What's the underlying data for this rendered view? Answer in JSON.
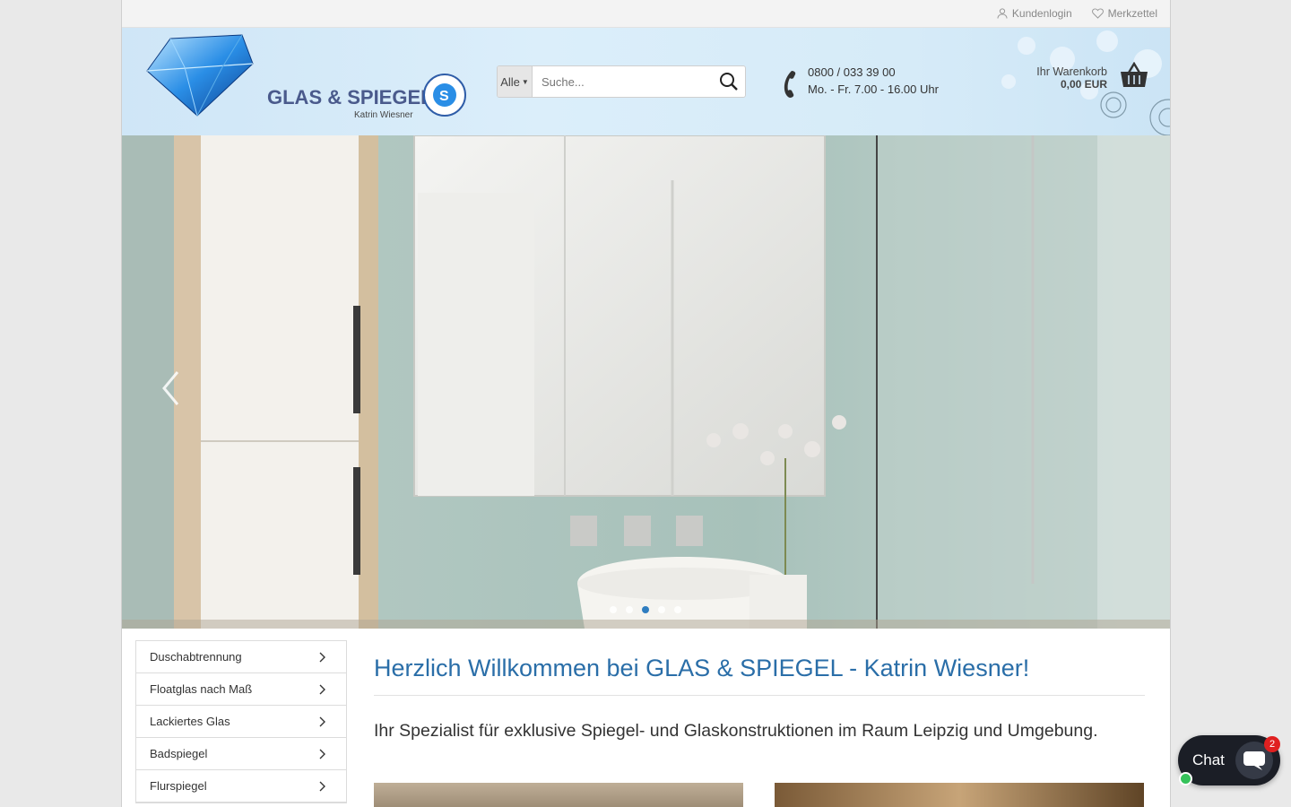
{
  "topbar": {
    "login_label": "Kundenlogin",
    "wishlist_label": "Merkzettel"
  },
  "header": {
    "logo_title": "GLAS & SPIEGEL",
    "logo_subtitle": "Katrin Wiesner",
    "seal_letter": "S",
    "search": {
      "category_label": "Alle",
      "placeholder": "Suche..."
    },
    "phone": "0800 / 033 39 00",
    "hours": "Mo. - Fr. 7.00 - 16.00 Uhr",
    "cart": {
      "label": "Ihr Warenkorb",
      "amount": "0,00 EUR"
    }
  },
  "hero": {
    "slide_count": 5,
    "active_slide": 3
  },
  "sidebar": {
    "items": [
      {
        "label": "Duschabtrennung"
      },
      {
        "label": "Floatglas nach Maß"
      },
      {
        "label": "Lackiertes Glas"
      },
      {
        "label": "Badspiegel"
      },
      {
        "label": "Flurspiegel"
      }
    ]
  },
  "main": {
    "heading": "Herzlich Willkommen bei GLAS & SPIEGEL - Katrin Wiesner!",
    "intro": "Ihr Spezialist für exklusive Spiegel- und Glaskonstruktionen im Raum Leipzig und Umgebung."
  },
  "chat": {
    "label": "Chat",
    "badge": "2"
  },
  "colors": {
    "heading_blue": "#2a6ea8",
    "slider_active": "#2f7dc0",
    "chat_bg": "#1b1e26",
    "badge_red": "#e02020",
    "online_green": "#35c25a"
  }
}
